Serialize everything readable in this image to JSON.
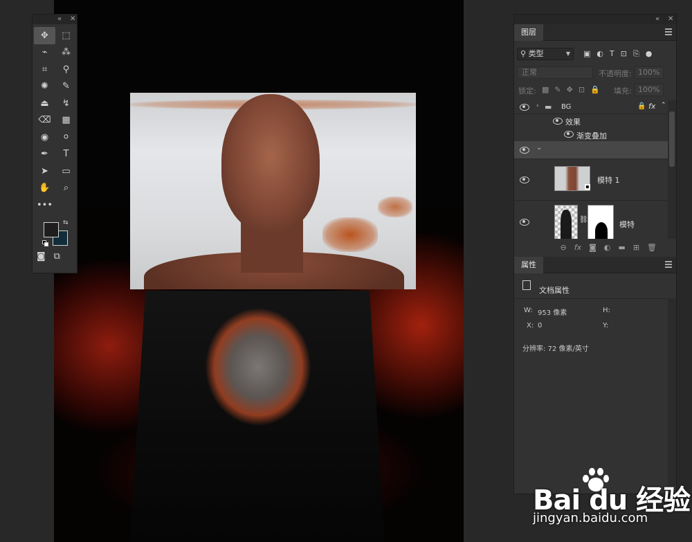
{
  "tools_panel": {
    "collapse_icon": "«",
    "close_icon": "✕",
    "tools": [
      {
        "icon": "move-tool-icon",
        "glyph": "✥",
        "active": true
      },
      {
        "icon": "marquee-tool-icon",
        "glyph": "⬚"
      },
      {
        "icon": "lasso-tool-icon",
        "glyph": "⌁"
      },
      {
        "icon": "magic-wand-tool-icon",
        "glyph": "⁂"
      },
      {
        "icon": "crop-tool-icon",
        "glyph": "⌗"
      },
      {
        "icon": "eyedropper-tool-icon",
        "glyph": "⚲"
      },
      {
        "icon": "spot-heal-tool-icon",
        "glyph": "✺"
      },
      {
        "icon": "brush-tool-icon",
        "glyph": "✎"
      },
      {
        "icon": "stamp-tool-icon",
        "glyph": "⏏"
      },
      {
        "icon": "history-brush-icon",
        "glyph": "↯"
      },
      {
        "icon": "eraser-tool-icon",
        "glyph": "⌫"
      },
      {
        "icon": "gradient-tool-icon",
        "glyph": "▦"
      },
      {
        "icon": "blur-tool-icon",
        "glyph": "◉"
      },
      {
        "icon": "dodge-tool-icon",
        "glyph": "⚪"
      },
      {
        "icon": "pen-tool-icon",
        "glyph": "✒"
      },
      {
        "icon": "type-tool-icon",
        "glyph": "T"
      },
      {
        "icon": "path-select-tool-icon",
        "glyph": "➤"
      },
      {
        "icon": "rectangle-tool-icon",
        "glyph": "▭"
      },
      {
        "icon": "hand-tool-icon",
        "glyph": "✋"
      },
      {
        "icon": "zoom-tool-icon",
        "glyph": "⌕"
      }
    ],
    "more_icon": "•••",
    "foreground_color": "#1e1e1e",
    "background_color": "#112c3a",
    "quick_mask_glyph": "◙",
    "screen_mode_glyph": "⧉"
  },
  "layers_panel": {
    "tab_label": "图层",
    "filter_label": "类型",
    "filter_icons": [
      "▣",
      "◐",
      "T",
      "⊡",
      "⎘",
      "●"
    ],
    "blend_mode": "正常",
    "opacity_label": "不透明度:",
    "opacity_value": "100%",
    "lock_label": "锁定:",
    "lock_icons": [
      "▩",
      "✎",
      "✥",
      "⊡",
      "🔒"
    ],
    "fill_label": "填充:",
    "fill_value": "100%",
    "layers": [
      {
        "name": "BG",
        "type": "group"
      },
      {
        "name": "效果",
        "type": "effects"
      },
      {
        "name": "渐变叠加",
        "type": "effect-item"
      },
      {
        "name": "",
        "type": "group-open"
      },
      {
        "name": "模特 1",
        "type": "smart"
      },
      {
        "name": "模特",
        "type": "masked"
      }
    ],
    "footer_icons": [
      "⊖",
      "fx",
      "◙",
      "◐",
      "▬",
      "⊞",
      "🗑"
    ]
  },
  "properties_panel": {
    "tab_label": "属性",
    "doc_title": "文档属性",
    "w_label": "W:",
    "w_value": "953 像素",
    "h_label": "H:",
    "h_value": "",
    "x_label": "X:",
    "x_value": "0",
    "y_label": "Y:",
    "y_value": "",
    "resolution": "分辨率: 72 像素/英寸"
  },
  "watermark": {
    "logo": "Bai  du 经验",
    "url": "jingyan.baidu.com"
  }
}
